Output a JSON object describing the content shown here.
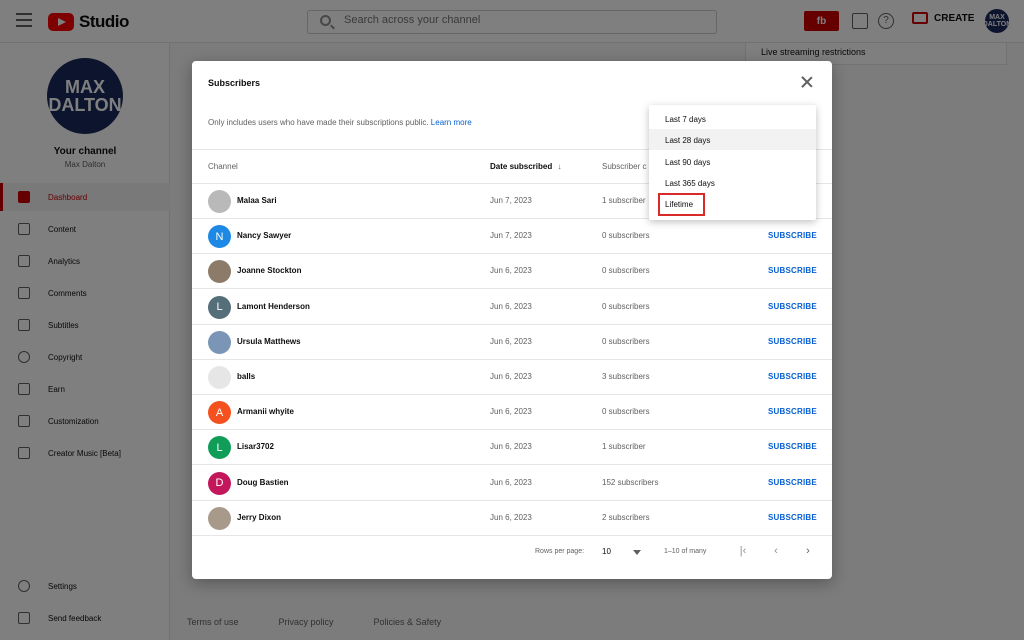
{
  "header": {
    "logo_text": "Studio",
    "search_placeholder": "Search across your channel",
    "ext_label": "fb",
    "help_glyph": "?",
    "create_label": "CREATE",
    "avatar_text": "MAX DALTON"
  },
  "sidebar": {
    "channel_avatar_text": "MAX DALTON",
    "channel_title": "Your channel",
    "channel_name": "Max Dalton",
    "items": [
      {
        "label": "Dashboard",
        "icon": "dashboard-icon",
        "active": true
      },
      {
        "label": "Content",
        "icon": "content-icon"
      },
      {
        "label": "Analytics",
        "icon": "analytics-icon"
      },
      {
        "label": "Comments",
        "icon": "comments-icon"
      },
      {
        "label": "Subtitles",
        "icon": "subtitles-icon"
      },
      {
        "label": "Copyright",
        "icon": "copyright-icon"
      },
      {
        "label": "Earn",
        "icon": "earn-icon"
      },
      {
        "label": "Customization",
        "icon": "customization-icon"
      },
      {
        "label": "Creator Music [Beta]",
        "icon": "music-icon"
      }
    ],
    "settings_label": "Settings",
    "feedback_label": "Send feedback"
  },
  "background": {
    "panel_text": "Live streaming restrictions",
    "footer_links": [
      "Terms of use",
      "Privacy policy",
      "Policies & Safety"
    ]
  },
  "dialog": {
    "title": "Subscribers",
    "note": "Only includes users who have made their subscriptions public.",
    "learn_more": "Learn more",
    "columns": {
      "channel": "Channel",
      "date": "Date subscribed",
      "subscribers": "Subscriber c"
    },
    "subscribe_label": "SUBSCRIBE",
    "rows": [
      {
        "name": "Malaa Sari",
        "date": "Jun 7, 2023",
        "subs": "1 subscriber",
        "initial": "",
        "color": "#b9b9b9"
      },
      {
        "name": "Nancy Sawyer",
        "date": "Jun 7, 2023",
        "subs": "0 subscribers",
        "initial": "N",
        "color": "#1e88e5"
      },
      {
        "name": "Joanne Stockton",
        "date": "Jun 6, 2023",
        "subs": "0 subscribers",
        "initial": "",
        "color": "#8d7b6a"
      },
      {
        "name": "Lamont Henderson",
        "date": "Jun 6, 2023",
        "subs": "0 subscribers",
        "initial": "L",
        "color": "#546e7a"
      },
      {
        "name": "Ursula Matthews",
        "date": "Jun 6, 2023",
        "subs": "0 subscribers",
        "initial": "",
        "color": "#7a95b5"
      },
      {
        "name": "balls",
        "date": "Jun 6, 2023",
        "subs": "3 subscribers",
        "initial": "",
        "color": "#e6e6e6"
      },
      {
        "name": "Armanii whyite",
        "date": "Jun 6, 2023",
        "subs": "0 subscribers",
        "initial": "A",
        "color": "#f4511e"
      },
      {
        "name": "Lisar3702",
        "date": "Jun 6, 2023",
        "subs": "1 subscriber",
        "initial": "L",
        "color": "#0f9d58"
      },
      {
        "name": "Doug Bastien",
        "date": "Jun 6, 2023",
        "subs": "152 subscribers",
        "initial": "D",
        "color": "#c2185b"
      },
      {
        "name": "Jerry Dixon",
        "date": "Jun 6, 2023",
        "subs": "2 subscribers",
        "initial": "",
        "color": "#a89a8a"
      }
    ],
    "pager": {
      "rows_per_page_label": "Rows per page:",
      "rows_per_page_value": "10",
      "range": "1–10 of many"
    }
  },
  "dropdown": {
    "options": [
      "Last 7 days",
      "Last 28 days",
      "Last 90 days",
      "Last 365 days",
      "Lifetime"
    ],
    "hovered": "Last 28 days",
    "highlighted": "Lifetime"
  },
  "colors": {
    "accent_red": "#cc0000",
    "link_blue": "#065fd4",
    "highlight_box": "#d92929"
  }
}
